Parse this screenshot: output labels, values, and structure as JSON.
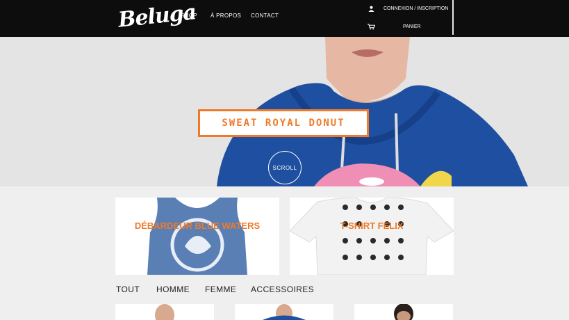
{
  "header": {
    "logo": "Beluga",
    "nav": [
      "SHOP",
      "À PROPOS",
      "CONTACT"
    ],
    "account_label": "CONNEXION / INSCRIPTION",
    "cart_label": "PANIER"
  },
  "hero": {
    "title": "SWEAT ROYAL DONUT",
    "scroll_label": "SCROLL"
  },
  "featured": [
    {
      "label": "DÉBARDEUR BLUE WATERS"
    },
    {
      "label": "T-SHIRT FELIX"
    }
  ],
  "categories": [
    "TOUT",
    "HOMME",
    "FEMME",
    "ACCESSOIRES"
  ],
  "colors": {
    "accent": "#f07a28",
    "topbar": "#0d0d0d",
    "hoodie_blue": "#1e4fa0"
  }
}
